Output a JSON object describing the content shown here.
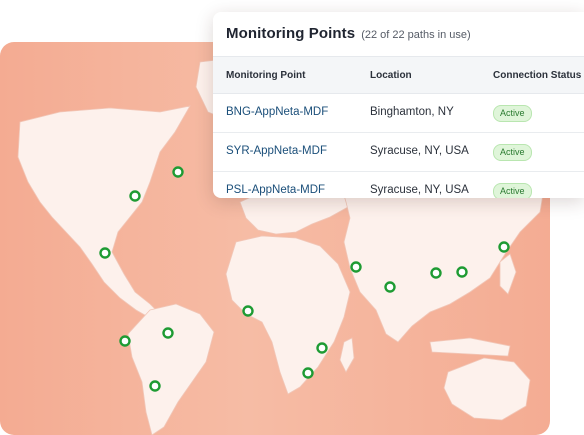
{
  "panel": {
    "title": "Monitoring Points",
    "subtitle": "(22 of 22 paths in use)",
    "columns": [
      "Monitoring Point",
      "Location",
      "Connection Status"
    ],
    "rows": [
      {
        "name": "BNG-AppNeta-MDF",
        "location": "Binghamton, NY",
        "status": "Active"
      },
      {
        "name": "SYR-AppNeta-MDF",
        "location": "Syracuse, NY, USA",
        "status": "Active"
      },
      {
        "name": "PSL-AppNeta-MDF",
        "location": "Syracuse, NY, USA",
        "status": "Active"
      }
    ]
  },
  "map": {
    "marker_icon": "location-ring-icon",
    "marker_count": 16
  },
  "colors": {
    "ocean": "#f4ab92",
    "land": "#fdf1ec",
    "marker_stroke": "#1e9b33",
    "link": "#1b4f7a",
    "badge_bg": "#dff5d9",
    "badge_text": "#2a7a30"
  }
}
